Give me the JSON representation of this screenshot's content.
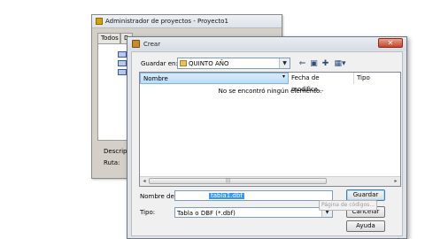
{
  "bg_window": {
    "title": "Administrador de proyectos - Proyecto1",
    "tabs": [
      "Todos",
      "D",
      "",
      ""
    ],
    "labels": {
      "description": "Descrip",
      "path": "Ruta:"
    }
  },
  "dialog": {
    "title": "Crear",
    "save_in_label": "Guardar en:",
    "save_in_value": "QUINTO AÑO",
    "columns": [
      "Nombre",
      "Fecha de modifica...",
      "Tipo"
    ],
    "empty_message": "No se encontró ningún elemento.",
    "filename_label": "Nombre de",
    "filename_value": "tabla1.dbf",
    "type_label": "Tipo:",
    "type_value": "Tabla o DBF (*.dbf)",
    "buttons": {
      "save": "Guardar",
      "cancel": "Cancelar",
      "help": "Ayuda",
      "codepage": "Página de códigos..."
    },
    "close_glyph": "✕"
  },
  "toolbar_icons": [
    "back-icon",
    "up-folder-icon",
    "new-folder-icon",
    "view-menu-icon"
  ]
}
